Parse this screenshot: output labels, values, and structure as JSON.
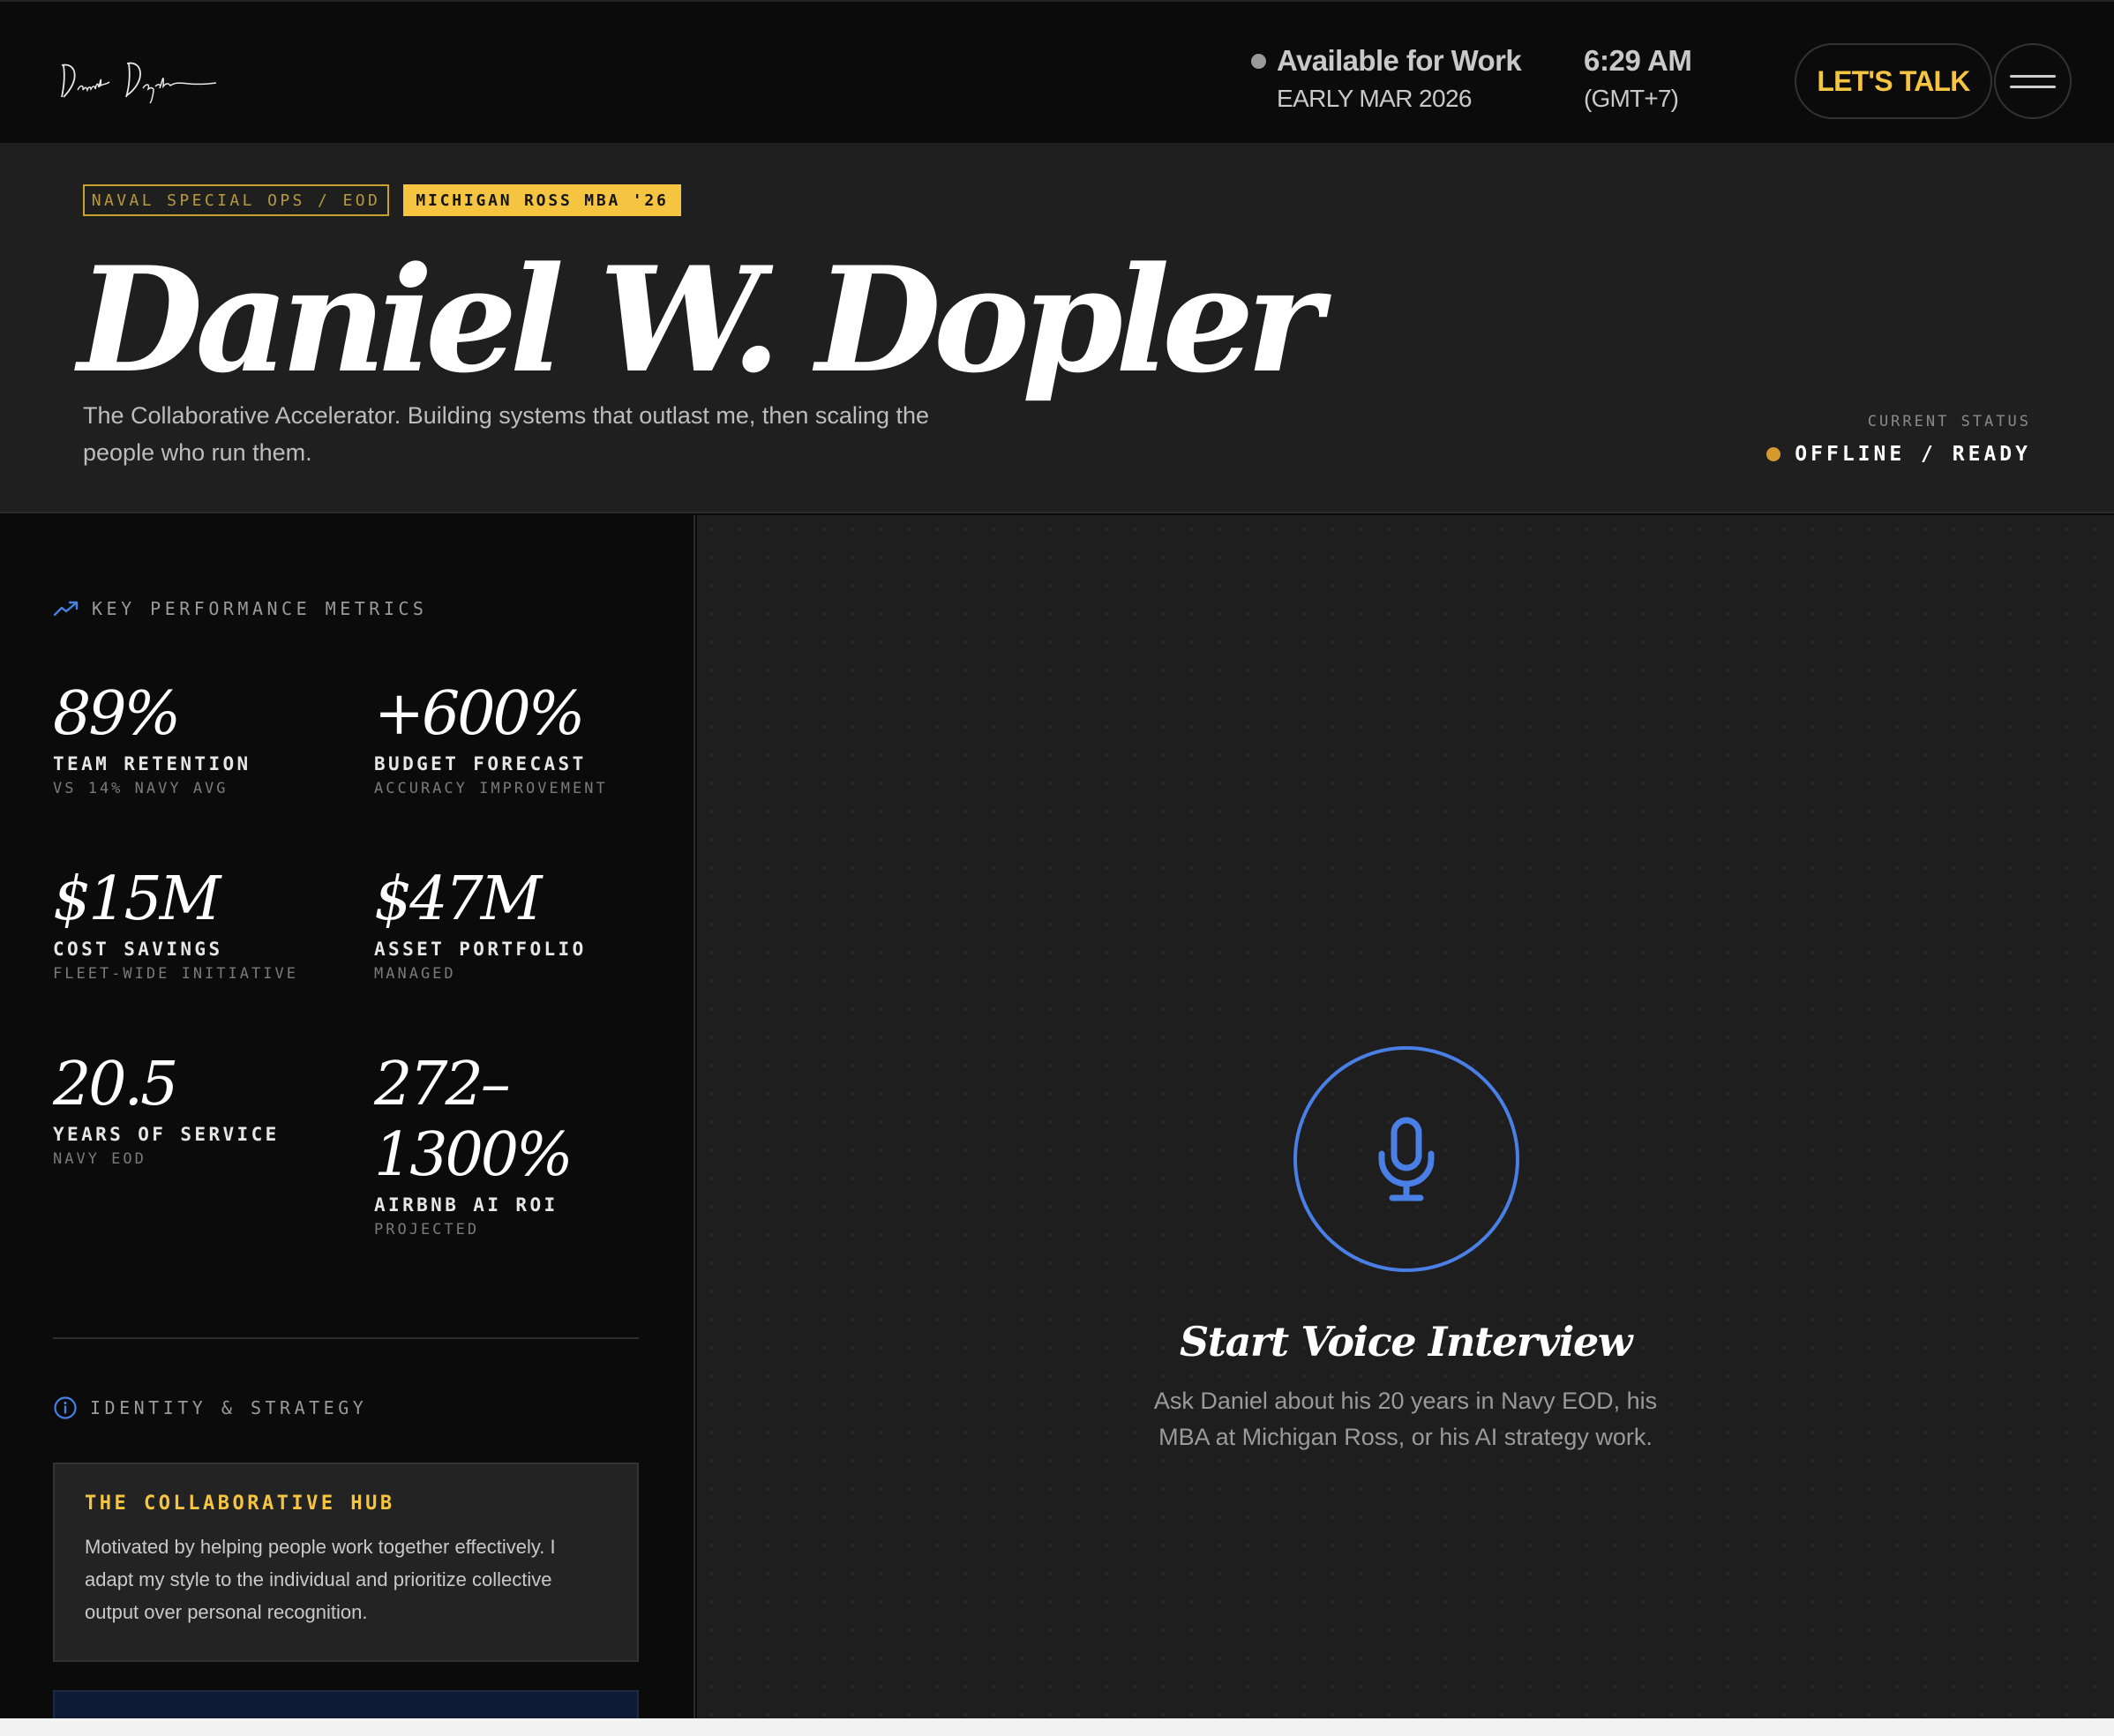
{
  "nav": {
    "logo_text": "Daniel Dopler",
    "availability_title": "Available for Work",
    "availability_date": "EARLY MAR 2026",
    "clock_time": "6:29 AM",
    "clock_timezone": "(GMT+7)",
    "cta_label": "LET'S TALK",
    "menu_icon": "hamburger-icon"
  },
  "hero": {
    "tags": [
      "NAVAL SPECIAL OPS / EOD",
      "MICHIGAN ROSS MBA '26"
    ],
    "name": "Daniel W. Dopler",
    "tagline": "The Collaborative Accelerator. Building systems that outlast me, then scaling the people who run them.",
    "status_label": "CURRENT STATUS",
    "status_value": "OFFLINE / READY",
    "status_color": "#d49a2e"
  },
  "sidebar": {
    "kpi_heading": "KEY PERFORMANCE METRICS",
    "kpi_icon": "trending-up-icon",
    "metrics": [
      {
        "value": "89%",
        "label": "TEAM RETENTION",
        "sub": "VS 14% NAVY AVG"
      },
      {
        "value": "+600%",
        "label": "BUDGET FORECAST",
        "sub": "ACCURACY IMPROVEMENT"
      },
      {
        "value": "$15M",
        "label": "COST SAVINGS",
        "sub": "FLEET-WIDE INITIATIVE"
      },
      {
        "value": "$47M",
        "label": "ASSET PORTFOLIO",
        "sub": "MANAGED"
      },
      {
        "value": "20.5",
        "label": "YEARS OF SERVICE",
        "sub": "NAVY EOD"
      },
      {
        "value_line1": "272–",
        "value_line2": "1300%",
        "label": "AIRBNB AI ROI",
        "sub": "PROJECTED"
      }
    ],
    "identity_heading": "IDENTITY & STRATEGY",
    "identity_icon": "info-icon",
    "hub_title": "THE COLLABORATIVE HUB",
    "hub_text": "Motivated by helping people work together effectively. I adapt my style to the individual and prioritize collective output over personal recognition."
  },
  "voice": {
    "icon": "microphone-icon",
    "title": "Start Voice Interview",
    "description": "Ask Daniel about his 20 years in Navy EOD, his MBA at Michigan Ross, or his AI strategy work."
  },
  "colors": {
    "accent_gold": "#f5c542",
    "accent_blue": "#4a7fe6",
    "background": "#0b0b0b",
    "panel": "#1f1f1f"
  }
}
